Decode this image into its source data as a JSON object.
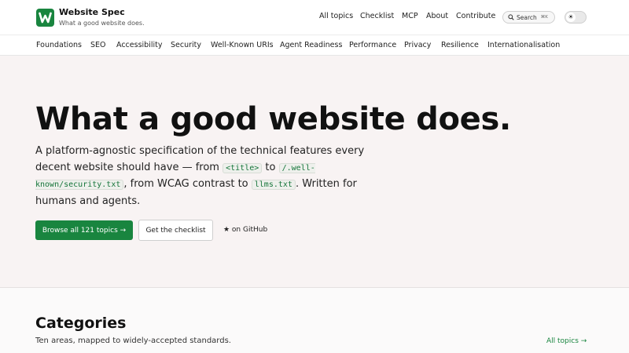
{
  "brand": {
    "logo_letter": "W",
    "title": "Website Spec",
    "tagline": "What a good website does."
  },
  "topnav": [
    "All topics",
    "Checklist",
    "MCP",
    "About",
    "Contribute"
  ],
  "search": {
    "label": "Search",
    "shortcut": "⌘K"
  },
  "theme_toggle": {
    "icon": "sun-icon"
  },
  "categories_nav": [
    "Foundations",
    "SEO",
    "Accessibility",
    "Security",
    "Well-Known URIs",
    "Agent Readiness",
    "Performance",
    "Privacy",
    "Resilience",
    "Internationalisation"
  ],
  "hero": {
    "title": "What a good website does.",
    "desc_part1": "A platform-agnostic specification of the technical features every decent website should have — from ",
    "code1": "<title>",
    "desc_part2": " to ",
    "code2": "/.well-known/security.txt",
    "desc_part3": ", from WCAG contrast to ",
    "code3": "llms.txt",
    "desc_part4": ". Written for humans and agents.",
    "primary_button": "Browse all 121 topics →",
    "secondary_button": "Get the checklist",
    "github_link": "★ on GitHub"
  },
  "categories_section": {
    "title": "Categories",
    "subtitle": "Ten areas, mapped to widely-accepted standards.",
    "all_topics_link": "All topics →"
  },
  "colors": {
    "accent": "#19853f",
    "hero_bg": "#f8f3f3",
    "code_text": "#16753a"
  }
}
